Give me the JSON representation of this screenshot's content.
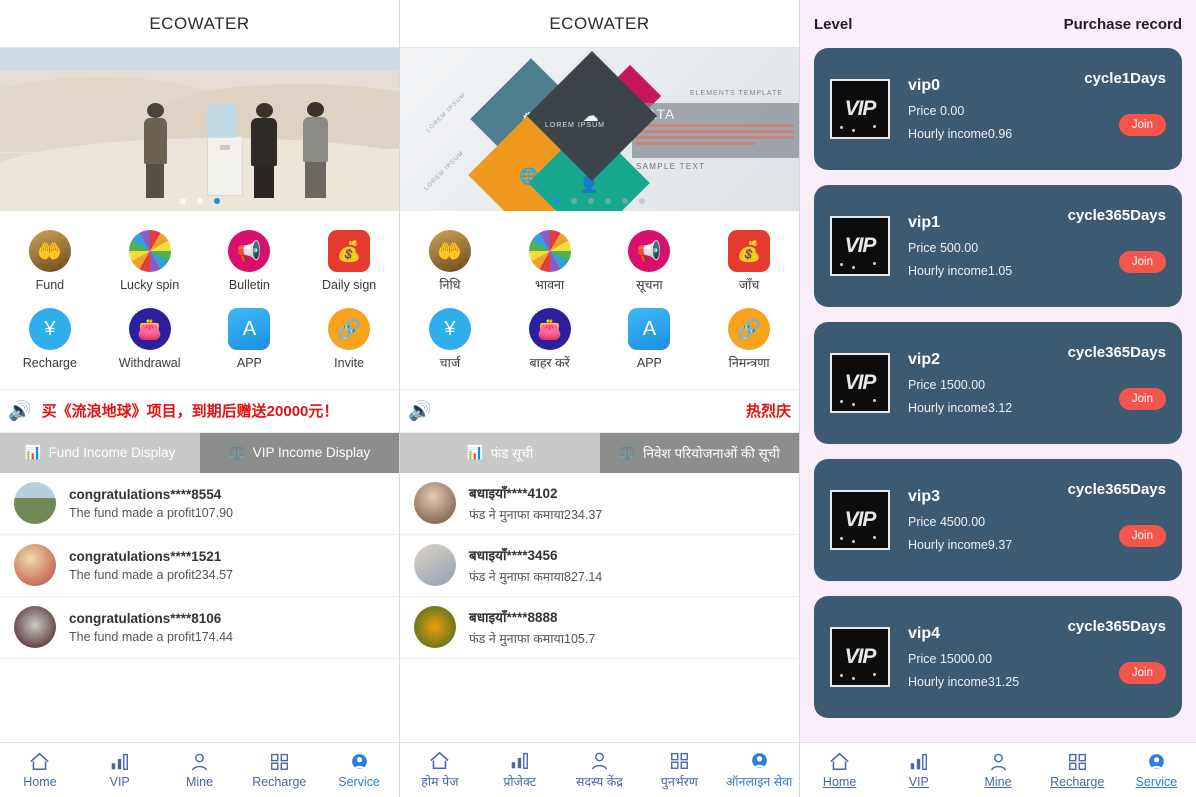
{
  "panel_en": {
    "title": "ECOWATER",
    "banner": {
      "name": "desert-water-cooler-banner",
      "dots": 3,
      "active_dot": 2
    },
    "icons": [
      {
        "label": "Fund",
        "icon": "fund-icon"
      },
      {
        "label": "Lucky spin",
        "icon": "lucky-spin-icon"
      },
      {
        "label": "Bulletin",
        "icon": "bulletin-megaphone-icon"
      },
      {
        "label": "Daily sign",
        "icon": "daily-sign-money-icon"
      },
      {
        "label": "Recharge",
        "icon": "recharge-yen-icon"
      },
      {
        "label": "Withdrawal",
        "icon": "withdrawal-wallet-icon"
      },
      {
        "label": "APP",
        "icon": "app-store-icon"
      },
      {
        "label": "Invite",
        "icon": "invite-link-icon"
      }
    ],
    "marquee": {
      "icon": "megaphone-icon",
      "text": "买《流浪地球》项目，到期后赠送20000元！"
    },
    "tabs": [
      {
        "label": "Fund Income Display",
        "icon": "bar-chart-icon",
        "active": false
      },
      {
        "label": "VIP Income Display",
        "icon": "scales-icon",
        "active": true
      }
    ],
    "records": [
      {
        "name": "congratulations****8554",
        "sub": "The fund made a profit107.90"
      },
      {
        "name": "congratulations****1521",
        "sub": "The fund made a profit234.57"
      },
      {
        "name": "congratulations****8106",
        "sub": "The fund made a profit174.44"
      }
    ],
    "nav": [
      {
        "label": "Home",
        "icon": "home-icon",
        "highlight": false
      },
      {
        "label": "VIP",
        "icon": "bars-icon",
        "highlight": false
      },
      {
        "label": "Mine",
        "icon": "person-icon",
        "highlight": false
      },
      {
        "label": "Recharge",
        "icon": "grid-icon",
        "highlight": false
      },
      {
        "label": "Service",
        "icon": "headset-icon",
        "highlight": true
      }
    ]
  },
  "panel_hi": {
    "title": "ECOWATER",
    "banner": {
      "name": "infographic-template-banner",
      "dots": 6,
      "active_dot": 1,
      "texts": {
        "elements_template": "ELEMENTS  TEMPLATE",
        "data": "DATA",
        "sample_text": "SAMPLE TEXT",
        "lorem": "LOREM IPSUM"
      }
    },
    "icons": [
      {
        "label": "निधि",
        "icon": "fund-icon"
      },
      {
        "label": "भावना",
        "icon": "lucky-spin-icon"
      },
      {
        "label": "सूचना",
        "icon": "bulletin-megaphone-icon"
      },
      {
        "label": "जाँच",
        "icon": "daily-sign-money-icon"
      },
      {
        "label": "चार्ज",
        "icon": "recharge-yen-icon"
      },
      {
        "label": "बाहर करें",
        "icon": "withdrawal-wallet-icon"
      },
      {
        "label": "APP",
        "icon": "app-store-icon"
      },
      {
        "label": "निमन्त्रणा",
        "icon": "invite-link-icon"
      }
    ],
    "marquee": {
      "icon": "megaphone-icon",
      "text": "热烈庆"
    },
    "tabs": [
      {
        "label": "फंड सूची",
        "icon": "bar-chart-icon",
        "active": false
      },
      {
        "label": "निवेश परियोजनाओं की सूची",
        "icon": "scales-icon",
        "active": true
      }
    ],
    "records": [
      {
        "name": "बधाइयाँ****4102",
        "sub": "फंड ने मुनाफा कमाया234.37"
      },
      {
        "name": "बधाइयाँ****3456",
        "sub": "फंड ने मुनाफा कमाया827.14"
      },
      {
        "name": "बधाइयाँ****8888",
        "sub": "फंड ने मुनाफा कमाया105.7"
      }
    ],
    "nav": [
      {
        "label": "होम पेज",
        "icon": "home-icon",
        "highlight": false
      },
      {
        "label": "प्रोजेक्ट",
        "icon": "bars-icon",
        "highlight": false
      },
      {
        "label": "सदस्य केंद्र",
        "icon": "person-icon",
        "highlight": false
      },
      {
        "label": "पुनर्भरण",
        "icon": "grid-icon",
        "highlight": false
      },
      {
        "label": "ऑनलाइन सेवा",
        "icon": "headset-icon",
        "highlight": true
      }
    ]
  },
  "panel_vip": {
    "header": {
      "left": "Level",
      "right": "Purchase record"
    },
    "join_label": "Join",
    "badge_text": "VIP",
    "cards": [
      {
        "name": "vip0",
        "cycle": "cycle1Days",
        "price": "Price 0.00",
        "income": "Hourly income0.96"
      },
      {
        "name": "vip1",
        "cycle": "cycle365Days",
        "price": "Price 500.00",
        "income": "Hourly income1.05"
      },
      {
        "name": "vip2",
        "cycle": "cycle365Days",
        "price": "Price 1500.00",
        "income": "Hourly income3.12"
      },
      {
        "name": "vip3",
        "cycle": "cycle365Days",
        "price": "Price 4500.00",
        "income": "Hourly income9.37"
      },
      {
        "name": "vip4",
        "cycle": "cycle365Days",
        "price": "Price 15000.00",
        "income": "Hourly income31.25"
      }
    ],
    "nav": [
      {
        "label": "Home",
        "icon": "home-icon",
        "highlight": false
      },
      {
        "label": "VIP",
        "icon": "bars-icon",
        "highlight": false
      },
      {
        "label": "Mine",
        "icon": "person-icon",
        "highlight": false
      },
      {
        "label": "Recharge",
        "icon": "grid-icon",
        "highlight": false
      },
      {
        "label": "Service",
        "icon": "headset-icon",
        "highlight": true
      }
    ]
  },
  "colors": {
    "vip_card": "#3d5a73",
    "vip_bg": "#faeefa",
    "join_button": "#f4564c",
    "marquee_text": "#e31212",
    "tab_active": "#8d8d8d",
    "tab_inactive": "#c9c9c9",
    "nav_label": "#4a66a8"
  }
}
